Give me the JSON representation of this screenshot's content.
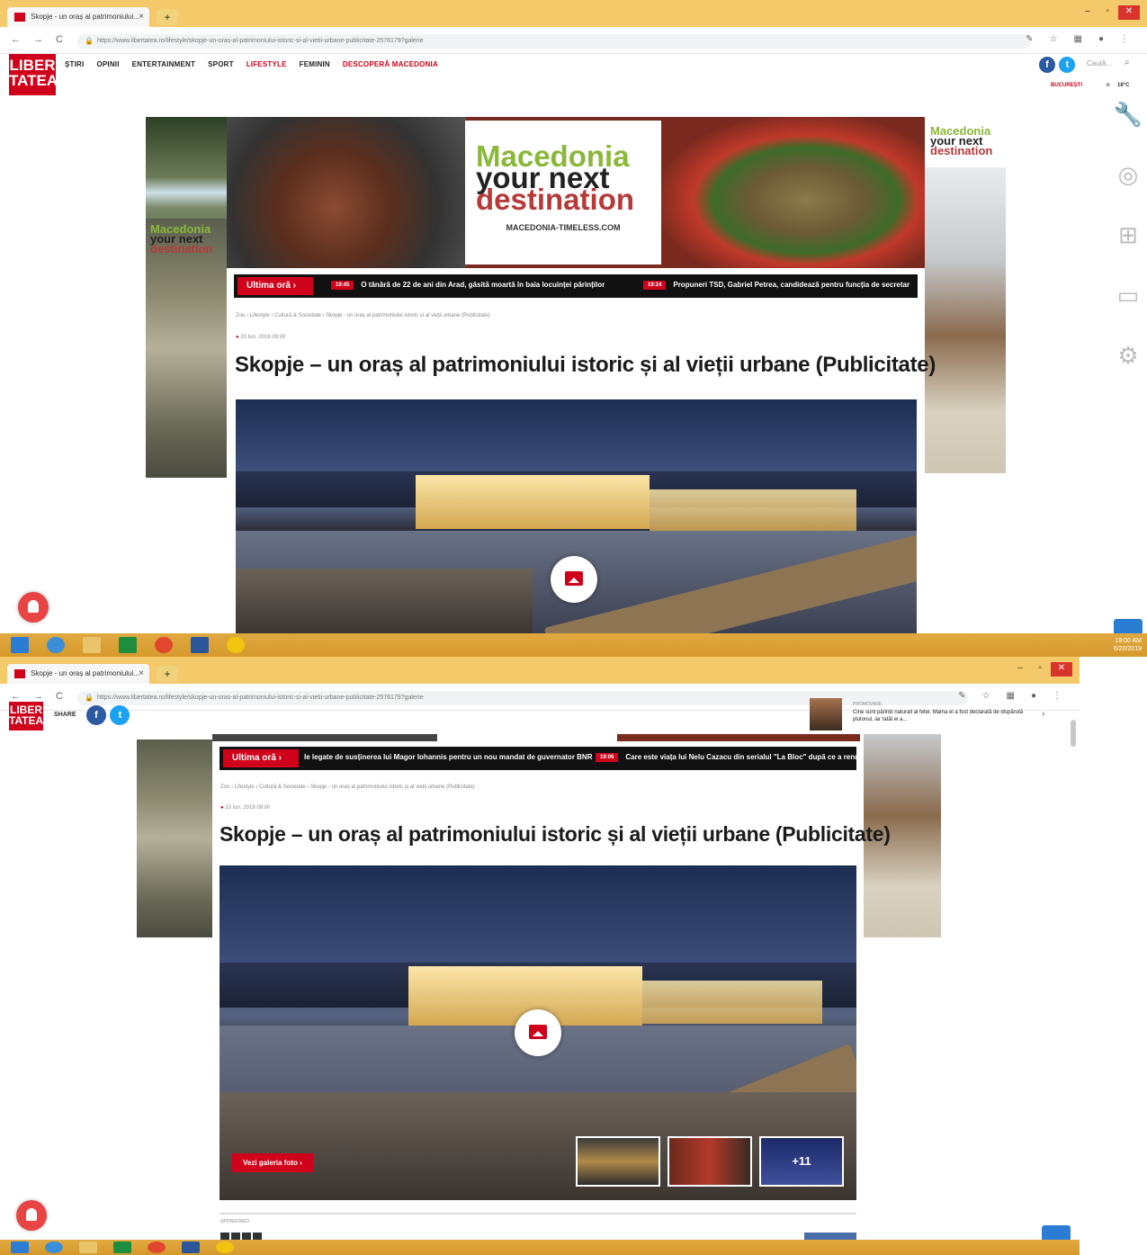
{
  "browser": {
    "tab_title": "Skopje - un oraș al patrimoniului...",
    "tab_close": "×",
    "new_tab": "+",
    "window_controls": [
      "–",
      "▫",
      "✕"
    ],
    "nav": [
      "←",
      "→",
      "C"
    ],
    "url": "https://www.libertatea.ro/lifestyle/skopje-un-oras-al-patrimoniului-istoric-si-al-vietii-urbane-publicitate-2576179?galerie",
    "extension_icons": [
      "✎",
      "☆",
      "▦",
      "●",
      "⋮"
    ]
  },
  "site": {
    "logo_line1": "LIBER",
    "logo_line2": "TATEA",
    "menu": [
      "ȘTIRI",
      "OPINII",
      "ENTERTAINMENT",
      "SPORT",
      "LIFESTYLE",
      "FEMININ",
      "DESCOPERĂ MACEDONIA"
    ],
    "active_menu": "LIFESTYLE",
    "accent_menu": "DESCOPERĂ MACEDONIA",
    "search_placeholder": "Caută...",
    "location": "BUCUREȘTI",
    "temperature": "18°C",
    "share_label": "SHARE",
    "accent_color": "#d0021b"
  },
  "ad": {
    "logo_l1": "Macedonia",
    "logo_l2": "your next",
    "logo_l3": "destination",
    "url": "MACEDONIA-TIMELESS.COM"
  },
  "ticker1": {
    "label": "Ultima oră ›",
    "items": [
      {
        "badge": "19:45",
        "text": "O tânără de 22 de ani din Arad, găsită moartă în baia locuinței părinților"
      },
      {
        "badge": "19:24",
        "text": "Propuneri TSD, Gabriel Petrea, candidează pentru funcția de secretar"
      }
    ]
  },
  "ticker2": {
    "label": "Ultima oră ›",
    "items": [
      {
        "badge": "",
        "text": "le legate de susținerea lui Magor Iohannis pentru un nou mandat de guvernator BNR"
      },
      {
        "badge": "19:06",
        "text": "Care este viața lui Nelu Cazacu din serialul \"La Bloc\" după ce a renunțat"
      }
    ]
  },
  "article": {
    "breadcrumb": "Zoo › Lifestyle › Cultură & Societate › Skopje - un oraș al patrimoniului istoric și al vieții urbane (Publicitate)",
    "date": "20 Iun. 2019 09:00",
    "title": "Skopje – un oraș al patrimoniului istoric și al vieții urbane (Publicitate)",
    "gallery_button": "Vezi galeria foto ›",
    "more_photos": "+11",
    "section_label": "SPONSORED",
    "promo_kicker": "PROMOVARE",
    "promo_text": "Cine sunt părinții naturali ai fetei. Mama ei a fost declarată de dispărută plutonul, iar tatăl ei a..."
  },
  "taskbar": {
    "clock_time": "19:00 AM",
    "clock_date": "6/20/2019"
  },
  "sidebar_icons": [
    "wrench-icon",
    "globe-icon",
    "windows-icon",
    "devices-icon",
    "gear-icon"
  ]
}
